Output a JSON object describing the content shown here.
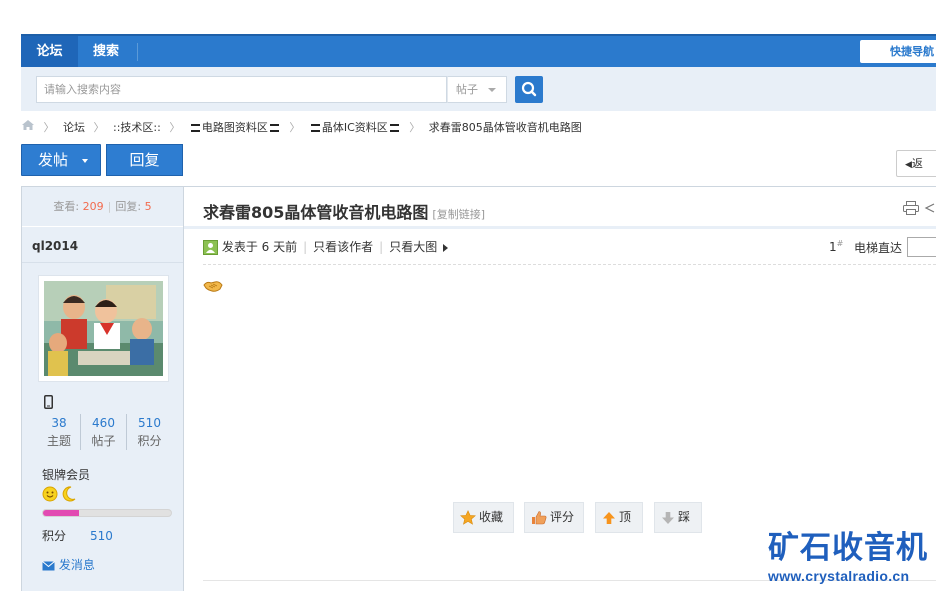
{
  "nav": {
    "forum": "论坛",
    "search": "搜索",
    "quick_nav": "快捷导航"
  },
  "search": {
    "placeholder": "请输入搜索内容",
    "type": "帖子"
  },
  "breadcrumb": {
    "forum": "论坛",
    "tech": "::技术区::",
    "circuit": "电路图资料区",
    "ic": "晶体IC资料区",
    "current": "求春雷805晶体管收音机电路图"
  },
  "buttons": {
    "post": "发帖",
    "reply": "回复",
    "back": "返"
  },
  "thread": {
    "views_label": "查看:",
    "views": "209",
    "replies_label": "回复:",
    "replies": "5",
    "title": "求春雷805晶体管收音机电路图",
    "copy_link": "[复制链接]",
    "posted": "发表于 6 天前",
    "only_author": "只看该作者",
    "only_large": "只看大图",
    "floor": "1",
    "floor_sup": "#",
    "jump": "电梯直达"
  },
  "author": {
    "name": "ql2014",
    "topics": "38",
    "topics_label": "主题",
    "posts": "460",
    "posts_label": "帖子",
    "credits": "510",
    "credits_label": "积分",
    "rank": "银牌会员",
    "rank_progress": 0.28,
    "points_label": "积分",
    "points": "510",
    "message": "发消息"
  },
  "actions": {
    "favorite": "收藏",
    "rate": "评分",
    "up": "顶",
    "down": "踩"
  },
  "watermark": {
    "name": "矿石收音机",
    "url": "www.crystalradio.cn"
  },
  "colors": {
    "brand": "#2b7acd",
    "sidebar_bg": "#e8eff7",
    "accent_red": "#f26c4f",
    "progress": "#e24ab2"
  }
}
